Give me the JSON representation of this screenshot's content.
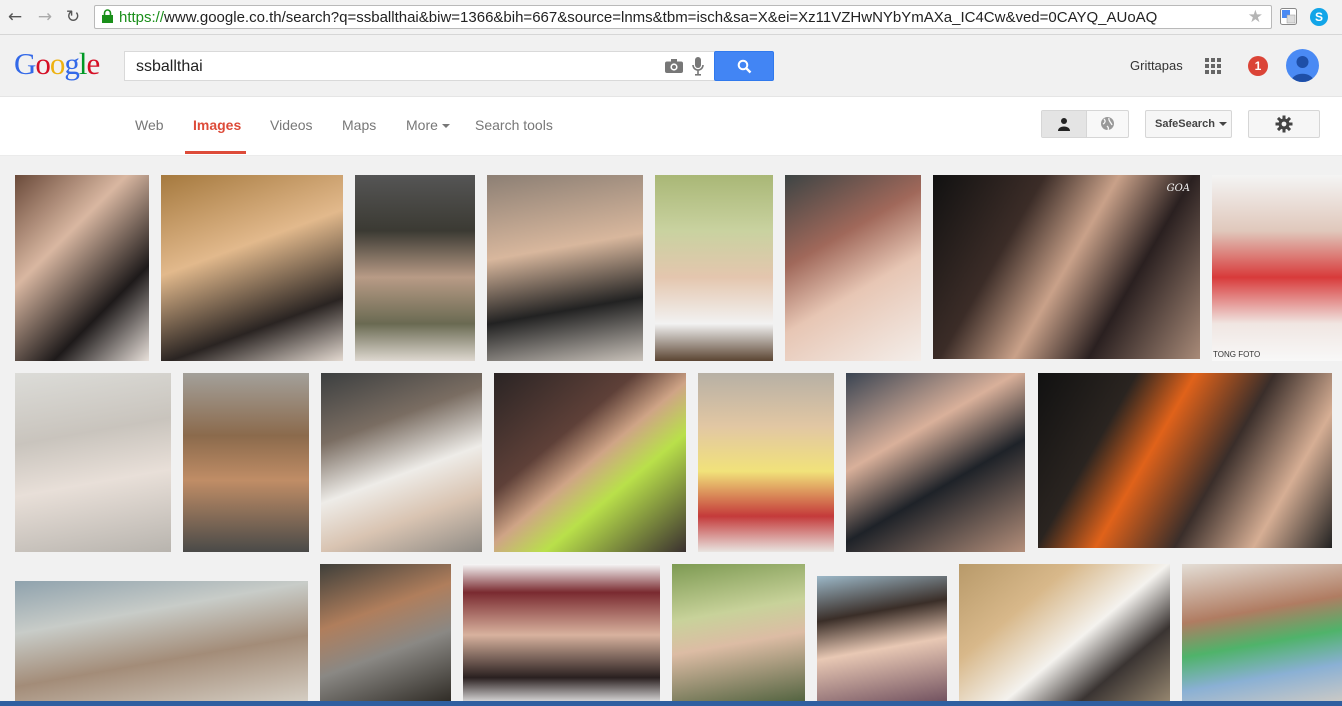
{
  "browser": {
    "url_protocol": "https://",
    "url_rest": "www.google.co.th/search?q=ssballthai&biw=1366&bih=667&source=lnms&tbm=isch&sa=X&ei=Xz11VZHwNYbYmAXa_IC4Cw&ved=0CAYQ_AUoAQ",
    "back_icon": "arrow-left-icon",
    "forward_icon": "arrow-right-icon",
    "reload_icon": "reload-icon",
    "bookmark_icon": "star-icon",
    "extension_icons": [
      "translate-icon",
      "skype-icon"
    ]
  },
  "header": {
    "logo_letters": [
      "G",
      "o",
      "o",
      "g",
      "l",
      "e"
    ],
    "search_value": "ssballthai",
    "user_name": "Grittapas",
    "notification_count": "1",
    "icons": [
      "camera-icon",
      "mic-icon",
      "search-icon",
      "apps-grid-icon",
      "avatar-icon"
    ]
  },
  "tabs": {
    "items": [
      "Web",
      "Images",
      "Videos",
      "Maps",
      "More",
      "Search tools"
    ],
    "active": "Images",
    "safesearch_label": "SafeSearch",
    "toggle_icons": [
      "person-icon",
      "globe-icon"
    ],
    "settings_icon": "gear-icon"
  },
  "colors": {
    "accent_red": "#dd4b39",
    "search_blue": "#4285f4",
    "url_green": "#1a8f1a"
  },
  "results": {
    "thumb_count": 22,
    "visible_caption_1": "GOA",
    "visible_caption_2": "TONG FOTO"
  }
}
